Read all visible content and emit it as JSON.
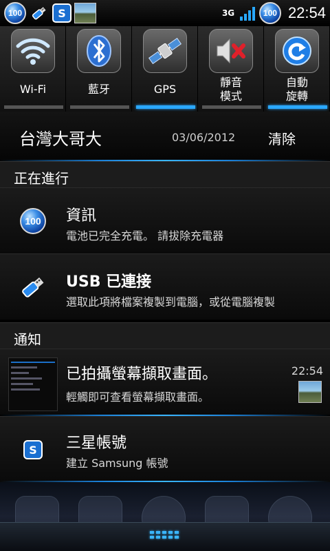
{
  "status_bar": {
    "battery_badge": "100",
    "network_type": "3G",
    "time": "22:54",
    "icons": [
      "battery-100-icon",
      "usb-icon",
      "samsung-account-icon",
      "screenshot-icon",
      "signal-icon"
    ]
  },
  "toggles": [
    {
      "label": "Wi-Fi",
      "icon": "wifi-icon",
      "on": false
    },
    {
      "label": "藍牙",
      "icon": "bluetooth-icon",
      "on": false
    },
    {
      "label": "GPS",
      "icon": "gps-satellite-icon",
      "on": true
    },
    {
      "label": "靜音\n模式",
      "line1": "靜音",
      "line2": "模式",
      "icon": "mute-icon",
      "on": false
    },
    {
      "label": "自動\n旋轉",
      "line1": "自動",
      "line2": "旋轉",
      "icon": "rotate-icon",
      "on": true
    }
  ],
  "carrier": {
    "name": "台灣大哥大",
    "date": "03/06/2012",
    "clear_label": "清除"
  },
  "ongoing": {
    "header": "正在進行",
    "items": [
      {
        "title": "資訊",
        "subtitle": "電池已完全充電。 請拔除充電器",
        "icon": "battery-100-icon",
        "badge": "100"
      },
      {
        "title": "USB 已連接",
        "subtitle": "選取此項將檔案複製到電腦，或從電腦複製",
        "icon": "usb-icon"
      }
    ]
  },
  "notifications": {
    "header": "通知",
    "items": [
      {
        "title": "已拍攝螢幕擷取畫面。",
        "subtitle": "輕觸即可查看螢幕擷取畫面。",
        "time": "22:54",
        "icon": "screenshot-thumbnail"
      },
      {
        "title": "三星帳號",
        "subtitle": "建立 Samsung 帳號",
        "icon": "samsung-account-icon",
        "badge": "S"
      }
    ]
  },
  "colors": {
    "accent": "#2aa8ff",
    "toggle_off": "#555555"
  }
}
